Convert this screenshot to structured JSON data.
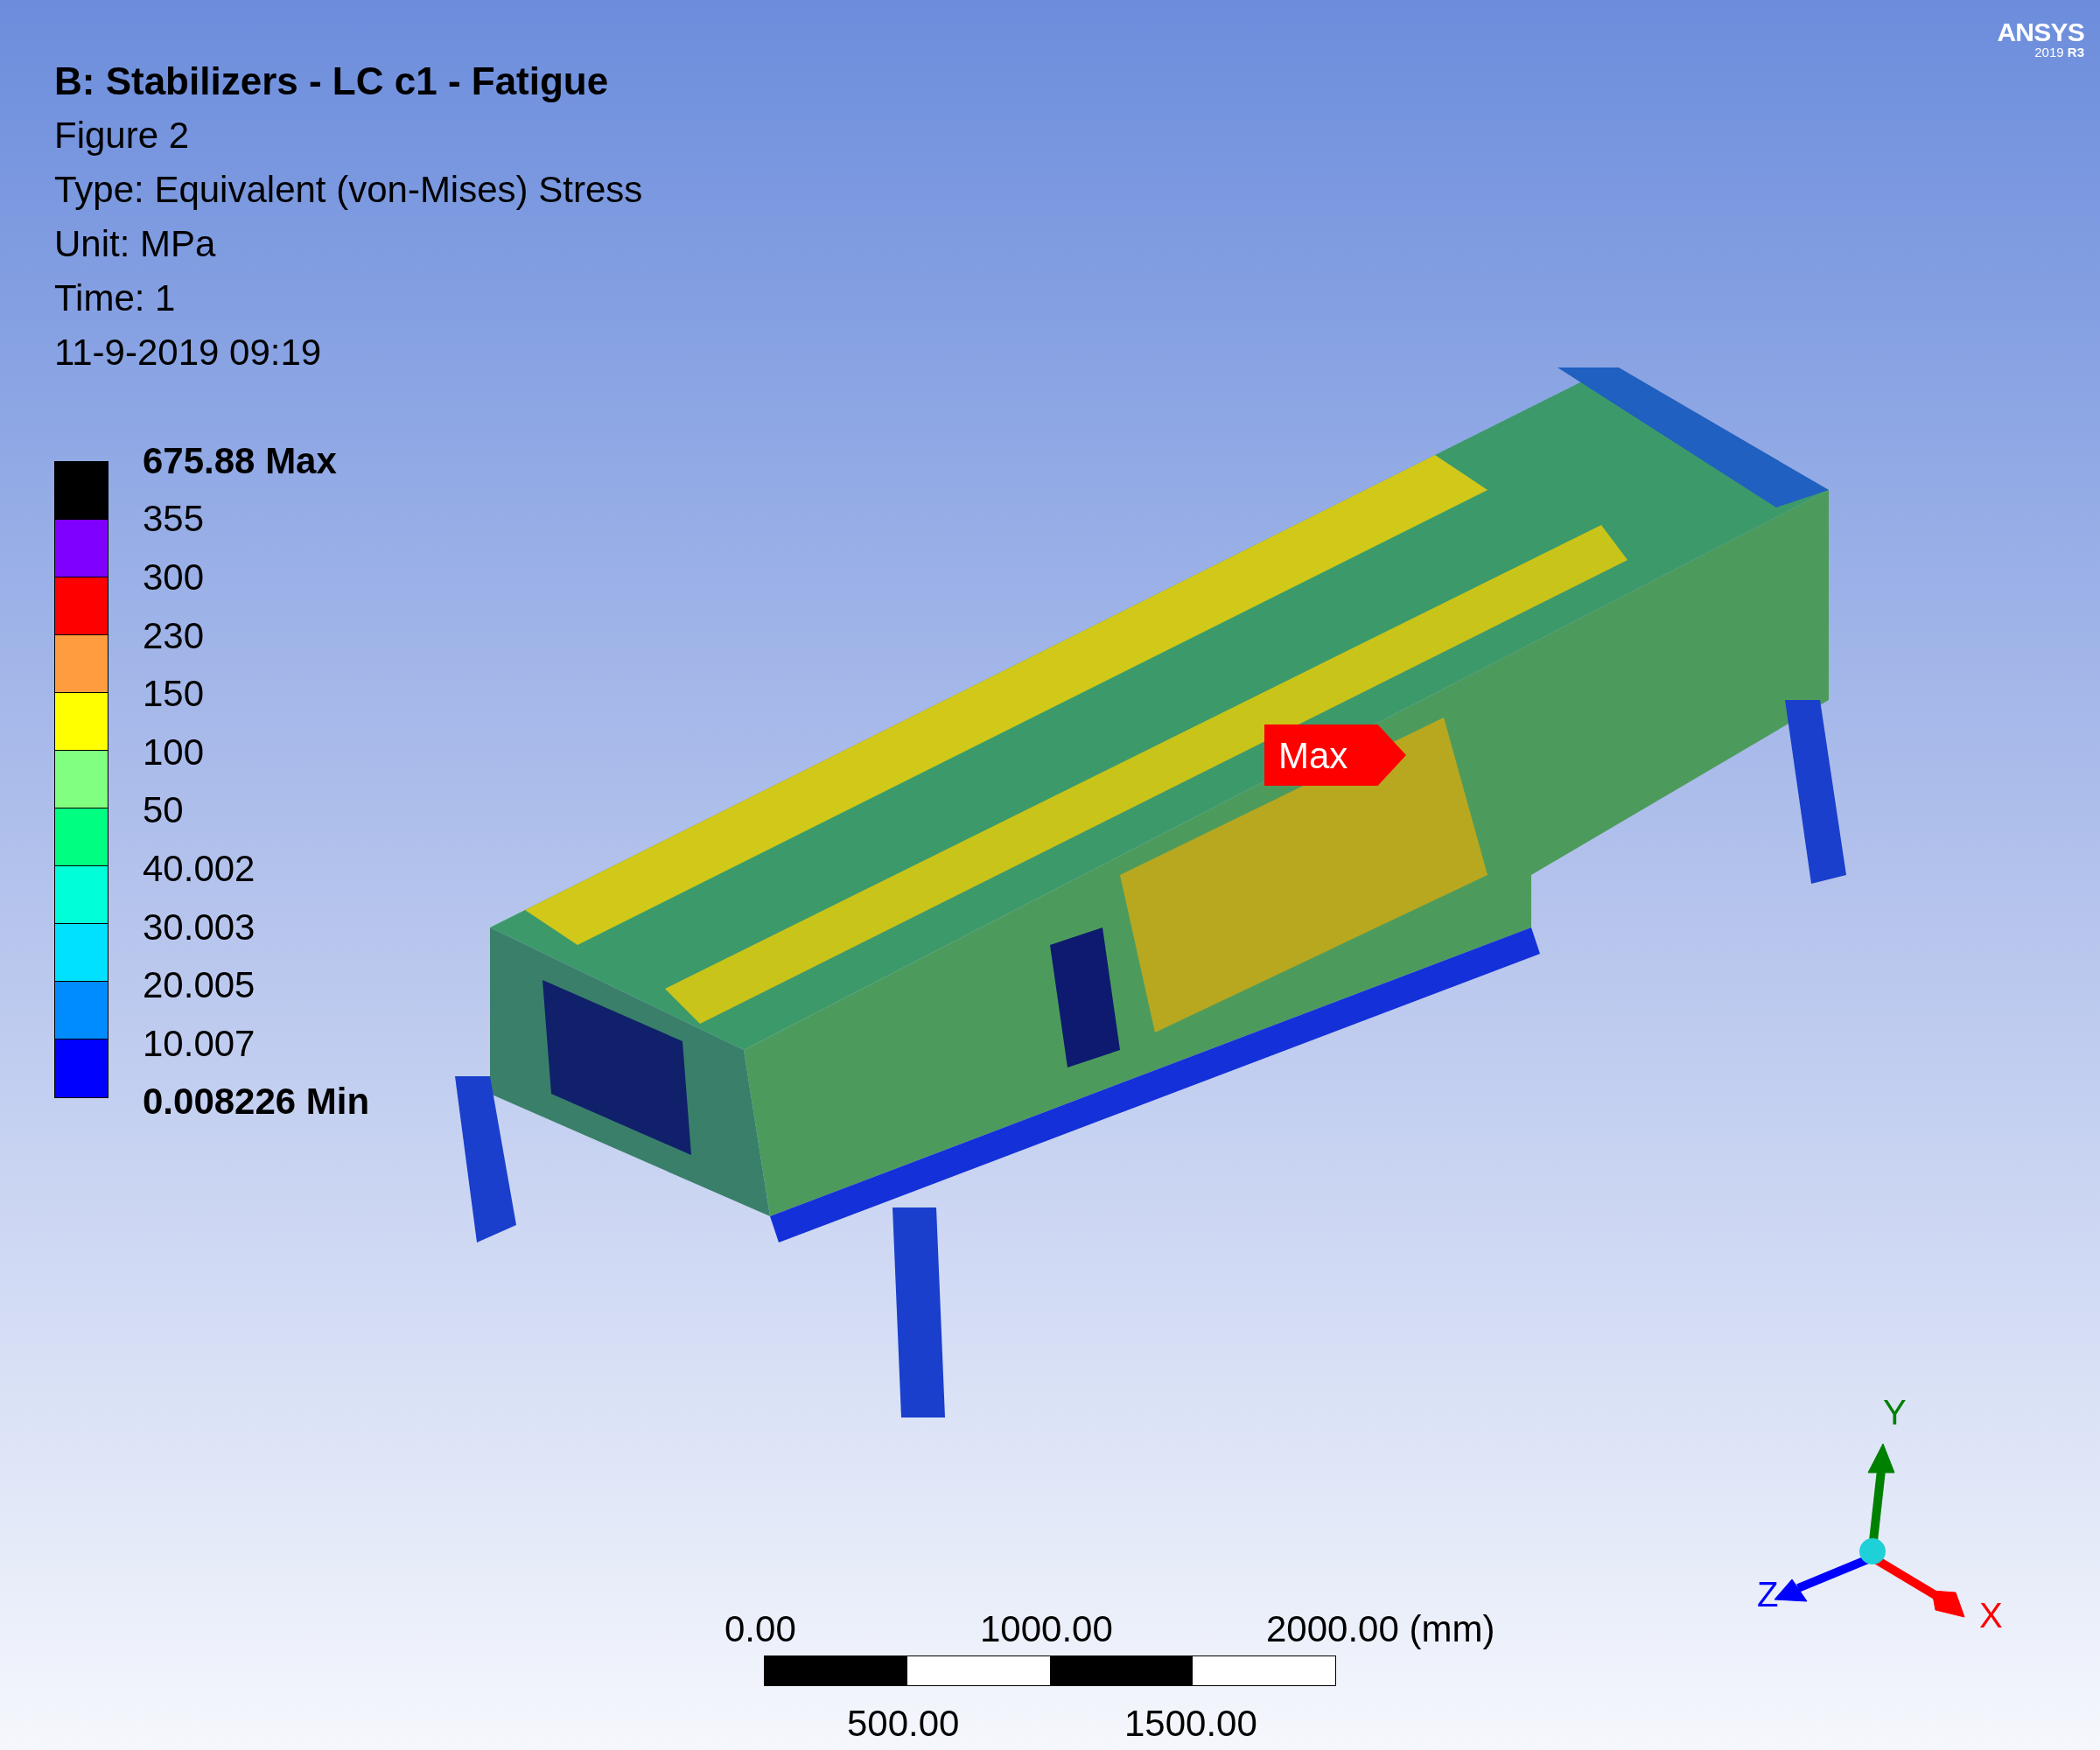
{
  "header": {
    "title": "B: Stabilizers - LC c1 - Fatigue",
    "lines": [
      "Figure 2",
      "Type: Equivalent (von-Mises) Stress",
      "Unit: MPa",
      "Time: 1",
      "11-9-2019 09:19"
    ]
  },
  "logo": {
    "brand": "ANSYS",
    "version": "2019",
    "release": "R3"
  },
  "legend": {
    "max_label": "675.88 Max",
    "min_label": "0.008226 Min",
    "levels": [
      "355",
      "300",
      "230",
      "150",
      "100",
      "50",
      "40.002",
      "30.003",
      "20.005",
      "10.007"
    ],
    "bands": [
      {
        "color": "#000000"
      },
      {
        "color": "#8000ff"
      },
      {
        "color": "#ff0000"
      },
      {
        "color": "#ff9c40"
      },
      {
        "color": "#ffff00"
      },
      {
        "color": "#80ff80"
      },
      {
        "color": "#00ff80"
      },
      {
        "color": "#00ffd9"
      },
      {
        "color": "#00e1ff"
      },
      {
        "color": "#008cff"
      },
      {
        "color": "#0000ff"
      }
    ]
  },
  "probe": {
    "label": "Max"
  },
  "scale_bar": {
    "top_labels": [
      "0.00",
      "1000.00",
      "2000.00 (mm)"
    ],
    "bottom_labels": [
      "500.00",
      "1500.00"
    ]
  },
  "triad": {
    "axes": [
      {
        "label": "Y",
        "color": "#008000"
      },
      {
        "label": "Z",
        "color": "#0000ff"
      },
      {
        "label": "X",
        "color": "#ff0000"
      }
    ]
  }
}
